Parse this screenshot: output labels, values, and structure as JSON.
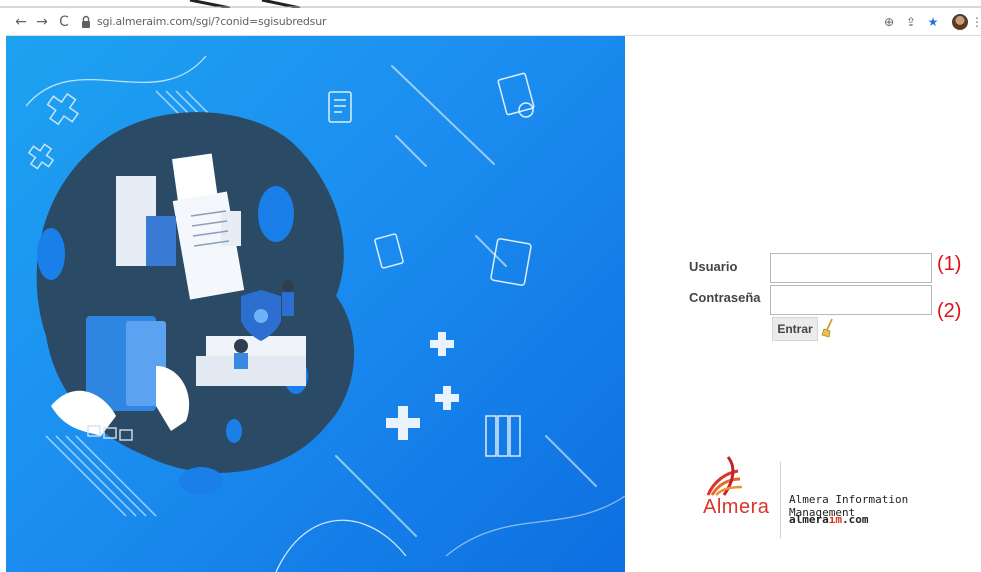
{
  "browser": {
    "url": "sgi.almeraim.com/sgi/?conid=sgisubredsur",
    "back_icon": "←",
    "forward_icon": "→",
    "reload_icon": "C",
    "zoom_icon": "⊕",
    "share_icon": "⇪",
    "bookmark_icon": "★",
    "menu_icon": "⋮"
  },
  "login": {
    "usuario_label": "Usuario",
    "contrasena_label": "Contraseña",
    "usuario_value": "",
    "contrasena_value": "",
    "submit_label": "Entrar",
    "marker_1": "(1)",
    "marker_2": "(2)"
  },
  "brand": {
    "logo_text": "Almera",
    "company_name": "Almera Information Management",
    "domain_prefix": "almera",
    "domain_accent": "im",
    "domain_suffix": ".com"
  },
  "colors": {
    "accent_red": "#e0101a",
    "brand_red": "#d9352a",
    "hero_blue": "#1c8ef0",
    "bookmark_blue": "#1a73e8"
  }
}
